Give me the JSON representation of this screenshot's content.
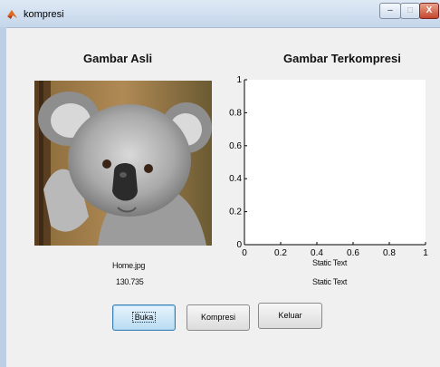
{
  "window": {
    "title": "kompresi",
    "controls": {
      "minimize": "–",
      "maximize": "□",
      "close": "X"
    }
  },
  "panels": {
    "original_heading": "Gambar Asli",
    "compressed_heading": "Gambar Terkompresi"
  },
  "axes": {
    "x_ticks": [
      "0",
      "0.2",
      "0.4",
      "0.6",
      "0.8",
      "1"
    ],
    "y_ticks": [
      "0",
      "0.2",
      "0.4",
      "0.6",
      "0.8",
      "1"
    ],
    "xlim": [
      0,
      1
    ],
    "ylim": [
      0,
      1
    ]
  },
  "info": {
    "file_name": "Home.jpg",
    "file_size": "130.735",
    "static_text_1": "Static Text",
    "static_text_2": "Static Text"
  },
  "buttons": {
    "open": "Buka",
    "compress": "Kompresi",
    "exit": "Keluar"
  },
  "icons": {
    "app": "matlab-icon",
    "image": "koala-photo"
  }
}
